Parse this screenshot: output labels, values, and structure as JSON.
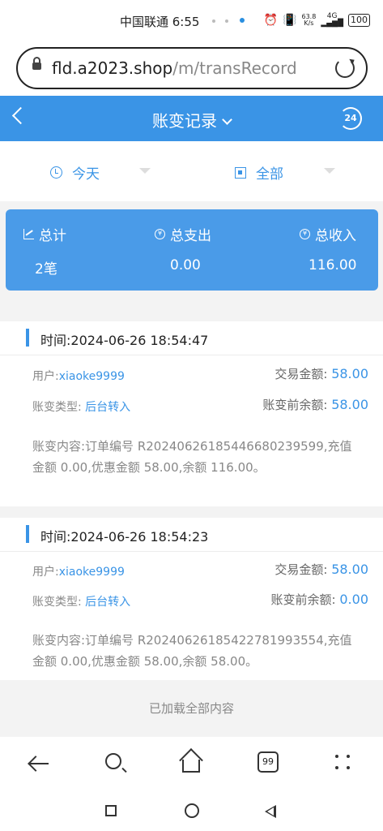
{
  "status_bar": {
    "time": "中国联通 6:55",
    "net_speed_value": "63.8",
    "net_speed_unit": "K/s",
    "signal": "4G",
    "battery": "100"
  },
  "browser": {
    "url_host": "fld.a2023.shop",
    "url_path": "/m/transRecord"
  },
  "header": {
    "title": "账变记录",
    "support_badge": "24"
  },
  "filters": {
    "date": "今天",
    "type": "全部"
  },
  "summary": {
    "total_label": "总计",
    "total_value": "2笔",
    "expense_label": "总支出",
    "expense_value": "0.00",
    "income_label": "总收入",
    "income_value": "116.00"
  },
  "records": [
    {
      "time": "时间:2024-06-26 18:54:47",
      "user_label": "用户:",
      "user": "xiaoke9999",
      "amount_label": "交易金额:",
      "amount": "58.00",
      "type_label": "账变类型:",
      "type": "后台转入",
      "before_label": "账变前余额:",
      "before": "58.00",
      "content": "账变内容:订单编号 R20240626185446680239599,充值金额 0.00,优惠金额 58.00,余额 116.00。"
    },
    {
      "time": "时间:2024-06-26 18:54:23",
      "user_label": "用户:",
      "user": "xiaoke9999",
      "amount_label": "交易金额:",
      "amount": "58.00",
      "type_label": "账变类型:",
      "type": "后台转入",
      "before_label": "账变前余额:",
      "before": "0.00",
      "content": "账变内容:订单编号 R20240626185422781993554,充值金额 0.00,优惠金额 58.00,余额 58.00。"
    }
  ],
  "list_footer": "已加载全部内容",
  "browser_nav": {
    "tabs_count": "99"
  }
}
